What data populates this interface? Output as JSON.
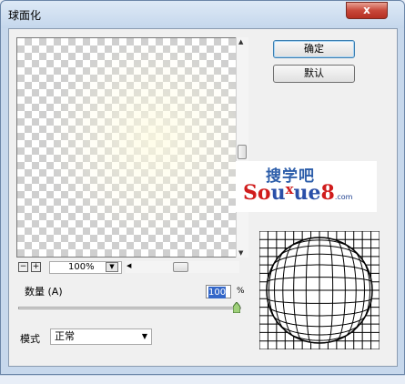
{
  "window": {
    "title": "球面化",
    "close_label": "x"
  },
  "preview": {
    "zoom_minus": "−",
    "zoom_plus": "+",
    "zoom_value": "100%"
  },
  "buttons": {
    "ok": "确定",
    "default": "默认"
  },
  "amount": {
    "label": "数量 (A)",
    "value": "100",
    "unit": "%",
    "slider_fraction": 1.0
  },
  "mode": {
    "label": "模式",
    "value": "正常"
  },
  "watermark": {
    "cn": "搜学吧",
    "en_domain": ".com"
  },
  "icons": {
    "close": "close-icon",
    "scroll_up": "scroll-up-arrow-icon",
    "scroll_down": "scroll-down-arrow-icon",
    "scroll_left": "scroll-left-arrow-icon",
    "dropdown": "chevron-down-icon"
  },
  "colors": {
    "accent": "#3467c8",
    "close": "#c8483a",
    "frame": "#c7d8ec"
  }
}
